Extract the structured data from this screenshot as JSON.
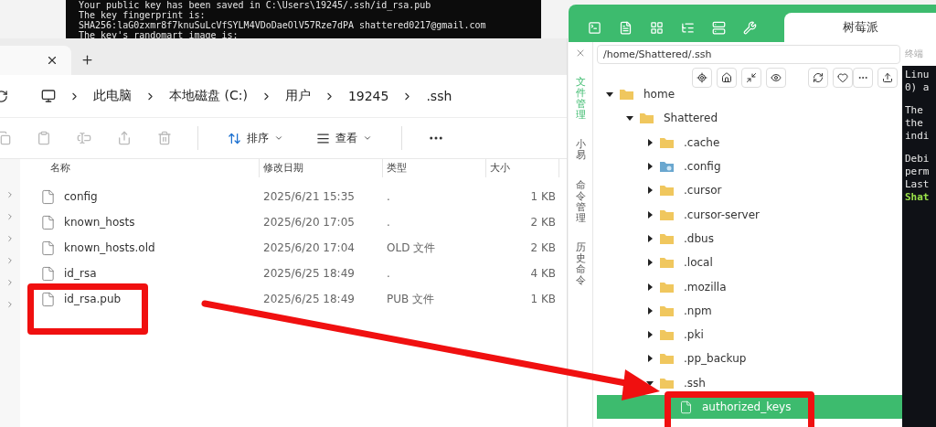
{
  "terminal": {
    "lines": [
      "Your public key has been saved in C:\\Users\\19245/.ssh/id_rsa.pub",
      "The key fingerprint is:",
      "SHA256:laG0zxmr8f7knuSuLcVfSYLM4VDoDaeOlV57Rze7dPA shattered0217@gmail.com",
      "The key's randomart image is:"
    ]
  },
  "explorer": {
    "breadcrumbs": [
      "此电脑",
      "本地磁盘 (C:)",
      "用户",
      "19245",
      ".ssh"
    ],
    "toolbar": {
      "sort": "排序",
      "view": "查看"
    },
    "columns": [
      "名称",
      "修改日期",
      "类型",
      "大小"
    ],
    "files": [
      {
        "name": "config",
        "modified": "2025/6/21 15:35",
        "type": ".",
        "size": "1 KB",
        "annotated": false
      },
      {
        "name": "known_hosts",
        "modified": "2025/6/20 17:05",
        "type": ".",
        "size": "2 KB",
        "annotated": false
      },
      {
        "name": "known_hosts.old",
        "modified": "2025/6/20 17:04",
        "type": "OLD 文件",
        "size": "2 KB",
        "annotated": false
      },
      {
        "name": "id_rsa",
        "modified": "2025/6/25 18:49",
        "type": ".",
        "size": "4 KB",
        "annotated": false
      },
      {
        "name": "id_rsa.pub",
        "modified": "2025/6/25 18:49",
        "type": "PUB 文件",
        "size": "1 KB",
        "annotated": true
      }
    ]
  },
  "remote": {
    "tabs": [
      {
        "label": "树莓派",
        "selected": true
      }
    ],
    "side_tabs": [
      {
        "label": "文件管理",
        "selected": true
      },
      {
        "label": "小易",
        "selected": false
      },
      {
        "label": "命令管理",
        "selected": false
      },
      {
        "label": "历史命令",
        "selected": false
      }
    ],
    "path": "/home/Shattered/.ssh",
    "tree": [
      {
        "name": "home",
        "kind": "folder",
        "expanded": true,
        "children": [
          {
            "name": "Shattered",
            "kind": "folder",
            "expanded": true,
            "children": [
              {
                "name": ".cache",
                "kind": "folder",
                "expanded": false
              },
              {
                "name": ".config",
                "kind": "special-folder",
                "expanded": false
              },
              {
                "name": ".cursor",
                "kind": "folder",
                "expanded": false
              },
              {
                "name": ".cursor-server",
                "kind": "folder",
                "expanded": false
              },
              {
                "name": ".dbus",
                "kind": "folder",
                "expanded": false
              },
              {
                "name": ".local",
                "kind": "folder",
                "expanded": false
              },
              {
                "name": ".mozilla",
                "kind": "folder",
                "expanded": false
              },
              {
                "name": ".npm",
                "kind": "folder",
                "expanded": false
              },
              {
                "name": ".pki",
                "kind": "folder",
                "expanded": false
              },
              {
                "name": ".pp_backup",
                "kind": "folder",
                "expanded": false
              },
              {
                "name": ".ssh",
                "kind": "folder",
                "expanded": true,
                "children": [
                  {
                    "name": "authorized_keys",
                    "kind": "file",
                    "selected": true,
                    "annotated": true
                  }
                ]
              }
            ]
          }
        ]
      }
    ],
    "terminal": {
      "label": "终端",
      "paragraphs": [
        [
          "Linu",
          "0) a"
        ],
        [
          "The",
          "the",
          "indi"
        ],
        [
          "Debi",
          "perm",
          "Last"
        ]
      ],
      "prompt": "Shat"
    }
  }
}
